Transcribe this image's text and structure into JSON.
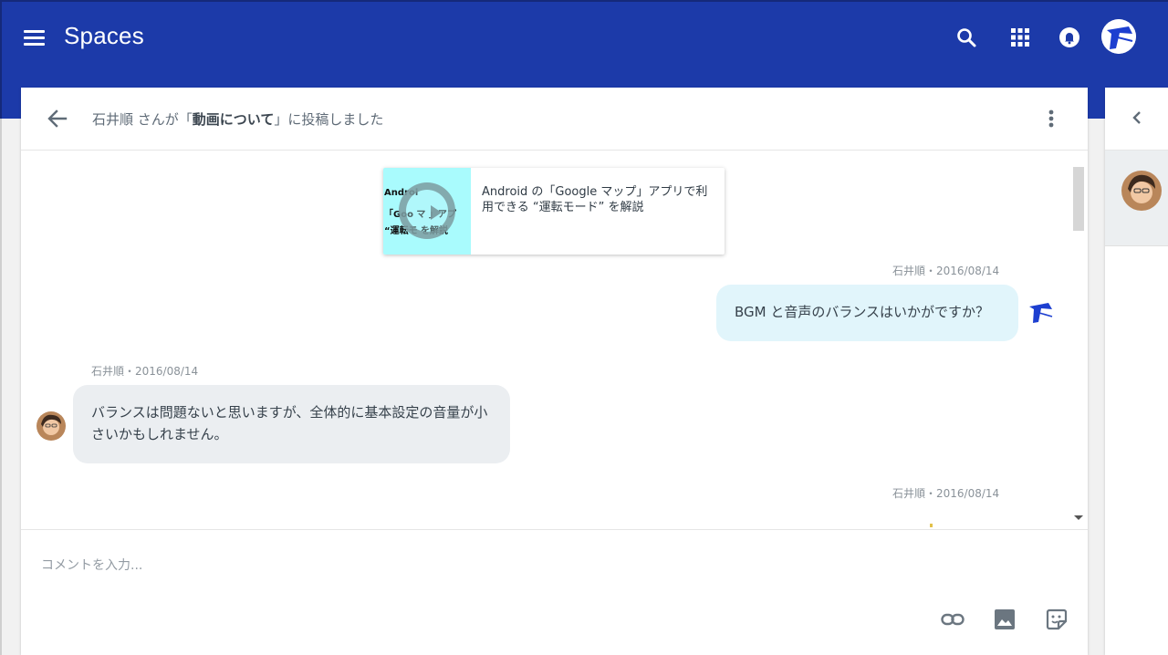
{
  "app": {
    "title": "Spaces",
    "brand_color": "#1c3aa9"
  },
  "topbar": {
    "icons": [
      "menu-icon",
      "search-icon",
      "apps-grid-icon",
      "notifications-bell-icon",
      "user-avatar"
    ]
  },
  "post": {
    "title_prefix": "石井順 さんが「",
    "title_space": "動画について",
    "title_suffix": "」に投稿しました",
    "link_card": {
      "thumb_lines": [
        "Androi",
        "「Goo マ 」アプ",
        "“運転モ を解説"
      ],
      "text": "Android の「Google マップ」アプリで利用できる “運転モード” を解説"
    }
  },
  "messages": [
    {
      "author_meta": "石井順・2016/08/14",
      "text": "BGM と音声のバランスはいかがですか？",
      "side": "right"
    },
    {
      "author_meta": "石井順・2016/08/14",
      "text": "バランスは問題ないと思いますが、全体的に基本設定の音量が小さいかもしれません。",
      "side": "left"
    },
    {
      "author_meta": "石井順・2016/08/14",
      "text": "",
      "side": "right"
    }
  ],
  "composer": {
    "placeholder": "コメントを入力...",
    "icons": [
      "link-icon",
      "image-icon",
      "sticker-icon"
    ]
  },
  "side_panel": {
    "icons": [
      "chevron-left-icon",
      "member-avatar"
    ]
  }
}
